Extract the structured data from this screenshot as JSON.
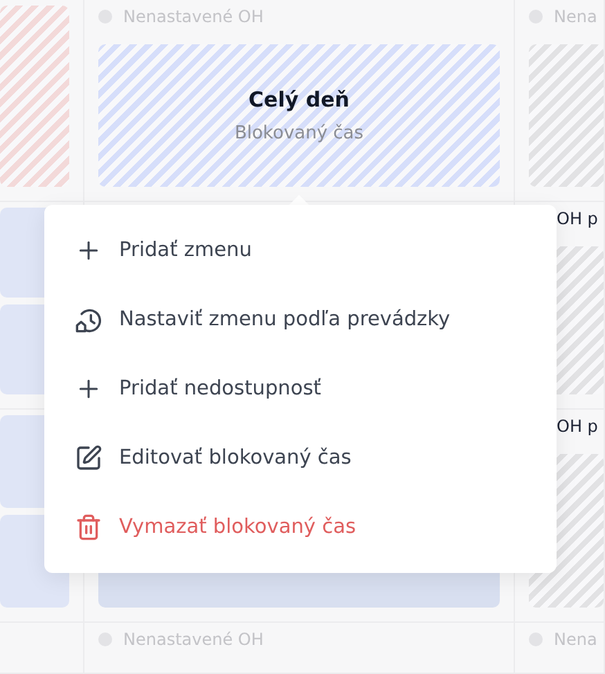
{
  "calendar": {
    "rows": [
      {
        "cells": [
          {
            "cards": [
              {
                "kind": "striped",
                "color": "#f3d9d9"
              }
            ]
          },
          {
            "header": {
              "text": "Nenastavené OH",
              "dot": true
            },
            "cards": [
              {
                "kind": "striped",
                "color": "#d6defa",
                "title": "Celý deň",
                "subtitle": "Blokovaný čas"
              }
            ]
          },
          {
            "header": {
              "text": "Nena",
              "dot": true
            },
            "cards": [
              {
                "kind": "striped",
                "color": "#e2e2e4"
              }
            ]
          }
        ]
      },
      {
        "cells": [
          {
            "cards": [
              {
                "kind": "solid",
                "color": "#dfe5f6"
              },
              {
                "kind": "solid",
                "color": "#dfe5f6"
              }
            ]
          },
          {},
          {
            "header": {
              "text": "OH p",
              "dot": false
            },
            "cards": [
              {
                "kind": "striped",
                "color": "#e2e2e4"
              }
            ]
          }
        ]
      },
      {
        "cells": [
          {
            "cards": [
              {
                "kind": "solid",
                "color": "#dfe5f6"
              },
              {
                "kind": "solid",
                "color": "#dfe5f6"
              }
            ]
          },
          {
            "cards": [
              {
                "kind": "solid",
                "color": "#d8dff0"
              }
            ]
          },
          {
            "header": {
              "text": "OH p",
              "dot": false
            },
            "cards": [
              {
                "kind": "striped",
                "color": "#e2e2e4"
              }
            ]
          }
        ]
      },
      {
        "cells": [
          {},
          {
            "header": {
              "text": "Nenastavené OH",
              "dot": true
            }
          },
          {
            "header": {
              "text": "Nena",
              "dot": true
            }
          }
        ]
      }
    ]
  },
  "context_menu": {
    "items": [
      {
        "kind": "add",
        "label": "Pridať zmenu"
      },
      {
        "kind": "schedule",
        "label": "Nastaviť zmenu podľa prevádzky"
      },
      {
        "kind": "add",
        "label": "Pridať nedostupnosť"
      },
      {
        "kind": "edit",
        "label": "Editovať blokovaný čas"
      },
      {
        "kind": "delete",
        "label": "Vymazať blokovaný čas"
      }
    ]
  }
}
